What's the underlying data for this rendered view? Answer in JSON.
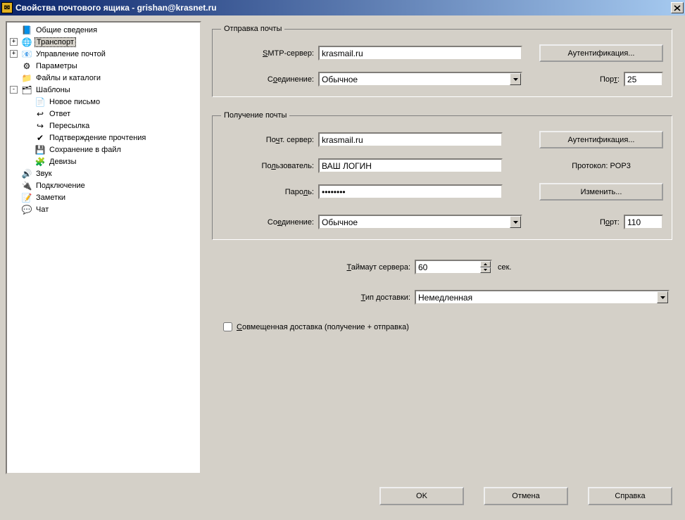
{
  "window": {
    "title": "Свойства почтового ящика - grishan@krasnet.ru",
    "close": "×"
  },
  "tree": {
    "items": [
      {
        "indent": 0,
        "expander": "blank",
        "icon": "📘",
        "label": "Общие сведения"
      },
      {
        "indent": 0,
        "expander": "plus",
        "icon": "🌐",
        "label": "Транспорт",
        "selected": true
      },
      {
        "indent": 0,
        "expander": "plus",
        "icon": "📧",
        "label": "Управление почтой"
      },
      {
        "indent": 0,
        "expander": "blank",
        "icon": "⚙",
        "label": "Параметры"
      },
      {
        "indent": 0,
        "expander": "blank",
        "icon": "📁",
        "label": "Файлы и каталоги"
      },
      {
        "indent": 0,
        "expander": "minus",
        "icon": "🗂",
        "label": "Шаблоны"
      },
      {
        "indent": 1,
        "expander": "dot",
        "icon": "📄",
        "label": "Новое письмо"
      },
      {
        "indent": 1,
        "expander": "dot",
        "icon": "↩",
        "label": "Ответ"
      },
      {
        "indent": 1,
        "expander": "dot",
        "icon": "↪",
        "label": "Пересылка"
      },
      {
        "indent": 1,
        "expander": "dot",
        "icon": "✔",
        "label": "Подтверждение прочтения"
      },
      {
        "indent": 1,
        "expander": "dot",
        "icon": "💾",
        "label": "Сохранение в файл"
      },
      {
        "indent": 1,
        "expander": "dot",
        "icon": "🧩",
        "label": "Девизы"
      },
      {
        "indent": 0,
        "expander": "blank",
        "icon": "🔊",
        "label": "Звук"
      },
      {
        "indent": 0,
        "expander": "blank",
        "icon": "🔌",
        "label": "Подключение"
      },
      {
        "indent": 0,
        "expander": "blank",
        "icon": "📝",
        "label": "Заметки"
      },
      {
        "indent": 0,
        "expander": "blank",
        "icon": "💬",
        "label": "Чат"
      }
    ]
  },
  "send": {
    "legend": "Отправка почты",
    "smtp_label": "SMTP-сервер:",
    "smtp_value": "krasmail.ru",
    "auth_btn": "Аутентификация...",
    "conn_label": "Соединение:",
    "conn_value": "Обычное",
    "port_label": "Порт:",
    "port_value": "25"
  },
  "recv": {
    "legend": "Получение почты",
    "server_label": "Почт. сервер:",
    "server_value": "krasmail.ru",
    "auth_btn": "Аутентификация...",
    "user_label": "Пользователь:",
    "user_value": "ВАШ ЛОГИН",
    "proto_label": "Протокол:  POP3",
    "pass_label": "Пароль:",
    "pass_value": "••••••••",
    "change_btn": "Изменить...",
    "conn_label": "Соединение:",
    "conn_value": "Обычное",
    "port_label": "Порт:",
    "port_value": "110"
  },
  "misc": {
    "timeout_label": "Таймаут сервера:",
    "timeout_value": "60",
    "timeout_units": "сек.",
    "delivery_label": "Тип доставки:",
    "delivery_value": "Немедленная",
    "combined_label": "Совмещенная доставка (получение + отправка)"
  },
  "footer": {
    "ok": "OK",
    "cancel": "Отмена",
    "help": "Справка"
  }
}
